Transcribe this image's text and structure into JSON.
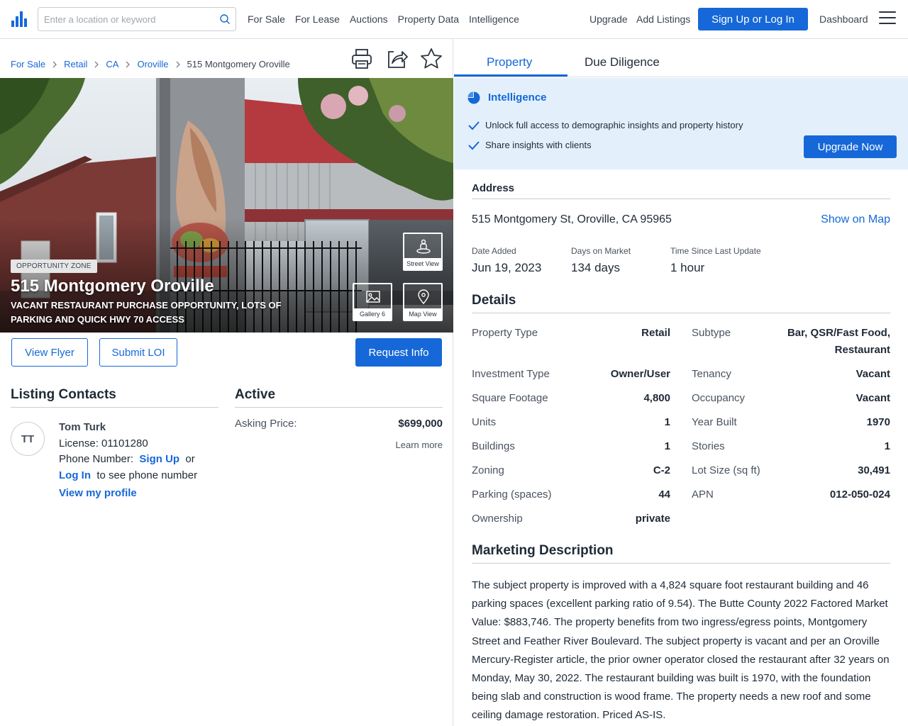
{
  "nav": {
    "search_placeholder": "Enter a location or keyword",
    "links": [
      "For Sale",
      "For Lease",
      "Auctions",
      "Property Data",
      "Intelligence"
    ],
    "upgrade": "Upgrade",
    "add_listings": "Add Listings",
    "signup": "Sign Up or Log In",
    "dashboard": "Dashboard"
  },
  "breadcrumb": [
    "For Sale",
    "Retail",
    "CA",
    "Oroville",
    "515 Montgomery Oroville"
  ],
  "hero": {
    "badge": "OPPORTUNITY ZONE",
    "title": "515 Montgomery Oroville",
    "subtitle": "VACANT RESTAURANT PURCHASE OPPORTUNITY, LOTS OF PARKING AND QUICK HWY 70 ACCESS",
    "street_view": "Street View",
    "gallery": "Gallery 6",
    "map_view": "Map View"
  },
  "actions": {
    "view_flyer": "View Flyer",
    "submit_loi": "Submit LOI",
    "request_info": "Request Info"
  },
  "contacts": {
    "heading": "Listing Contacts",
    "initials": "TT",
    "name": "Tom Turk",
    "license": "License: 01101280",
    "phone_label": "Phone Number:",
    "sign_up": "Sign Up",
    "or": "or",
    "log_in": "Log In",
    "phone_suffix": "to see phone number",
    "view_profile": "View my profile"
  },
  "status": {
    "heading": "Active",
    "asking_label": "Asking Price:",
    "asking_value": "$699,000",
    "learn_more": "Learn more"
  },
  "tabs": [
    "Property",
    "Due Diligence"
  ],
  "intelligence": {
    "title": "Intelligence",
    "items": [
      "Unlock full access to demographic insights and property history",
      "Share insights with clients"
    ],
    "upgrade_now": "Upgrade Now"
  },
  "address": {
    "heading": "Address",
    "line": "515 Montgomery St, Oroville, CA 95965",
    "show_on_map": "Show on Map",
    "stats": [
      {
        "label": "Date Added",
        "value": "Jun 19, 2023"
      },
      {
        "label": "Days on Market",
        "value": "134 days"
      },
      {
        "label": "Time Since Last Update",
        "value": "1 hour"
      }
    ]
  },
  "details": {
    "heading": "Details",
    "left": [
      {
        "label": "Property Type",
        "value": "Retail"
      },
      {
        "label": "Investment Type",
        "value": "Owner/User"
      },
      {
        "label": "Square Footage",
        "value": "4,800"
      },
      {
        "label": "Units",
        "value": "1"
      },
      {
        "label": "Buildings",
        "value": "1"
      },
      {
        "label": "Zoning",
        "value": "C-2"
      },
      {
        "label": "Parking (spaces)",
        "value": "44"
      },
      {
        "label": "Ownership",
        "value": "private"
      }
    ],
    "right": [
      {
        "label": "Subtype",
        "value": "Bar, QSR/Fast Food, Restaurant"
      },
      {
        "label": "Tenancy",
        "value": "Vacant"
      },
      {
        "label": "Occupancy",
        "value": "Vacant"
      },
      {
        "label": "Year Built",
        "value": "1970"
      },
      {
        "label": "Stories",
        "value": "1"
      },
      {
        "label": "Lot Size (sq ft)",
        "value": "30,491"
      },
      {
        "label": "APN",
        "value": "012-050-024"
      }
    ]
  },
  "marketing": {
    "heading": "Marketing Description",
    "text": "The subject property is improved with a 4,824 square foot restaurant building and 46 parking spaces (excellent parking ratio of 9.54). The Butte County 2022 Factored Market Value: $883,746. The property benefits from two ingress/egress points, Montgomery Street and Feather River Boulevard. The subject property is vacant and per an Oroville Mercury-Register article, the prior owner operator closed the restaurant after 32 years on Monday, May 30, 2022. The restaurant building was built is 1970, with the foundation being slab and construction is wood frame. The property needs a new roof and some ceiling damage restoration. Priced AS-IS."
  },
  "colors": {
    "accent": "#1668d8",
    "intel_bg": "#e3f0fc"
  }
}
